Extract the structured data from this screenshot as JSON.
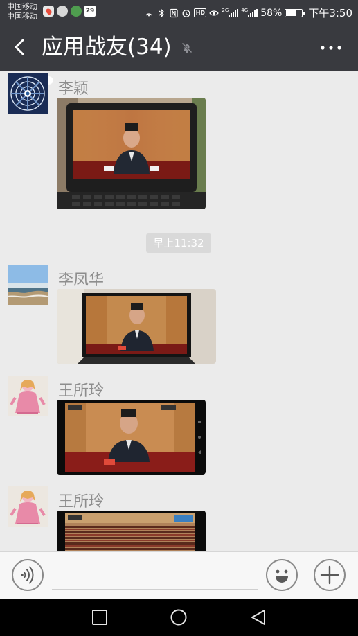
{
  "status_bar": {
    "carrier_1": "中国移动",
    "carrier_2": "中国移动",
    "calendar_day": "29",
    "network_1": "2G",
    "network_2": "4G",
    "hd_label": "HD",
    "battery": "58%",
    "time": "下午3:50",
    "notification_icons": [
      "map-pin-icon",
      "app-icon",
      "browser-icon",
      "chat-icon",
      "calendar-icon"
    ],
    "system_icons": [
      "hotspot-icon",
      "bluetooth-icon",
      "nfc-icon",
      "alarm-icon",
      "hd-icon",
      "eye-icon",
      "signal-icon",
      "signal-icon",
      "battery-icon"
    ]
  },
  "header": {
    "title": "应用战友(34)",
    "muted": true,
    "back_icon": "chevron-left-icon",
    "mute_icon": "bell-off-icon",
    "more_icon": "more-dots-icon"
  },
  "messages": [
    {
      "sender": "李颖",
      "avatar": "mandala-avatar",
      "type": "image",
      "image": "photo of laptop screen showing a speaker at a podium"
    },
    {
      "timestamp": "早上11:32"
    },
    {
      "sender": "李凤华",
      "avatar": "beach-avatar",
      "type": "image",
      "image": "photo of TV screen showing a speaker at a podium"
    },
    {
      "sender": "王所玲",
      "avatar": "doll-avatar",
      "type": "image",
      "image": "photo of phone screen showing a speaker at a podium"
    },
    {
      "sender": "王所玲",
      "avatar": "doll-avatar",
      "type": "image",
      "image": "photo of phone screen showing an assembly hall"
    }
  ],
  "input_bar": {
    "voice_icon": "voice-icon",
    "emoji_icon": "emoji-icon",
    "plus_icon": "plus-icon",
    "placeholder": ""
  },
  "nav_bar": {
    "buttons": [
      "recents-square-icon",
      "home-circle-icon",
      "back-triangle-icon"
    ]
  },
  "colors": {
    "header_bg": "#393a3f",
    "chat_bg": "#ebebeb",
    "timestamp_bg": "#d9d9d9",
    "sender_text": "#8d8d8d"
  }
}
